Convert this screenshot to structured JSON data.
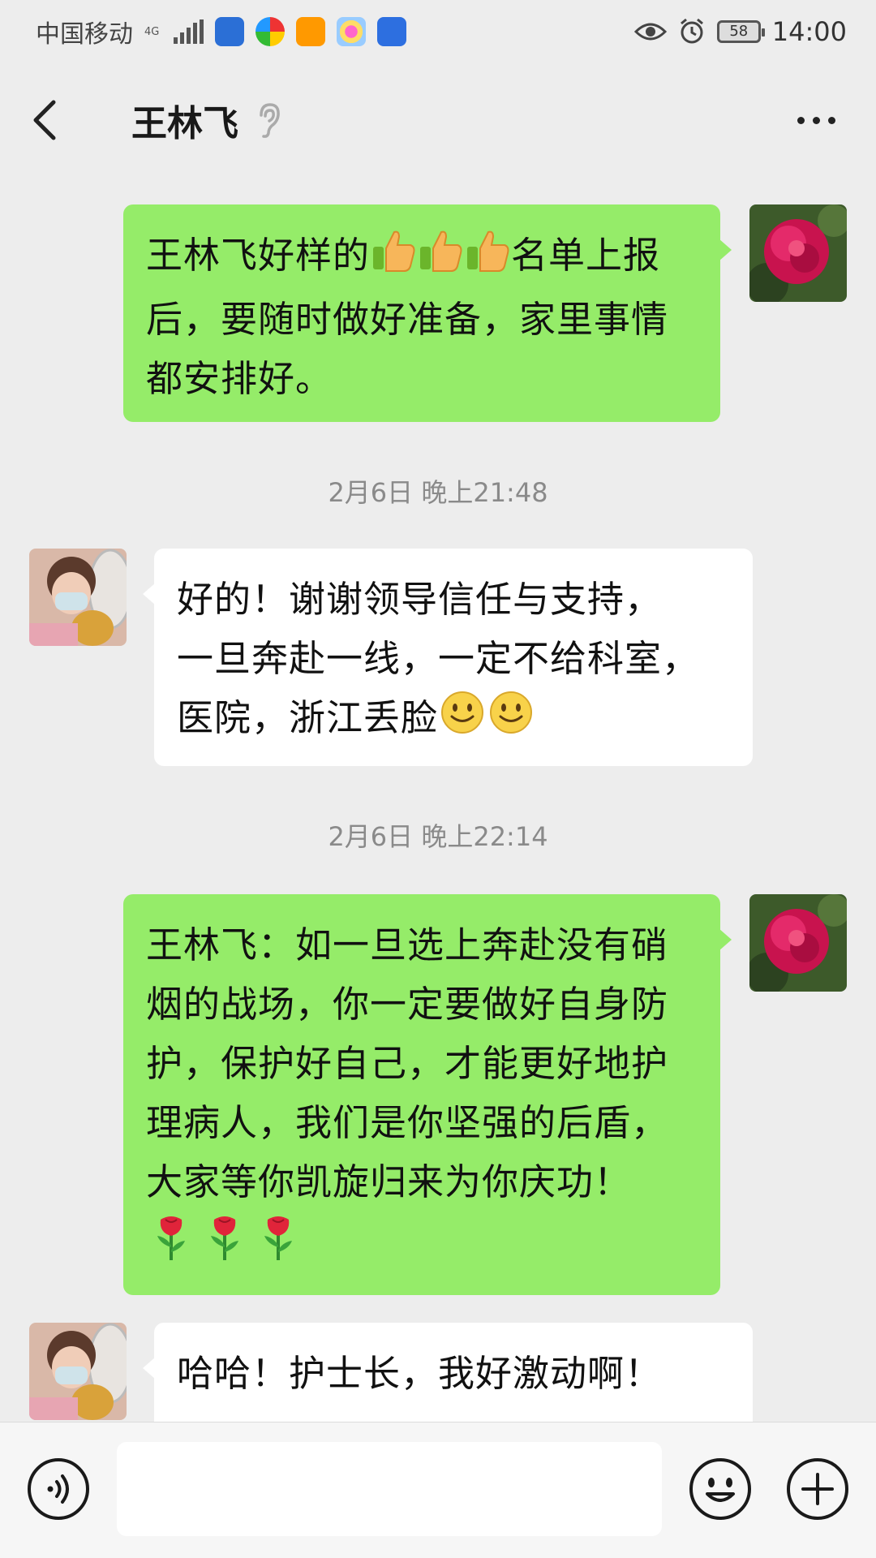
{
  "status_bar": {
    "carrier": "中国移动",
    "network": "4G",
    "battery": "58",
    "time": "14:00"
  },
  "header": {
    "contact_name": "王林飞",
    "back_icon": "chevron-left-icon",
    "mute_icon": "ear-icon",
    "more_icon": "more-dots-icon"
  },
  "messages": [
    {
      "side": "right",
      "text_lines": [
        "王林飞好样的",
        "名单上报",
        "后，要随时做好准备，家里事情",
        "都安排好。"
      ],
      "emoji": "thumbs-up"
    },
    {
      "timestamp": "2月6日 晚上21:48"
    },
    {
      "side": "left",
      "text_lines": [
        "好的！谢谢领导信任与支持，",
        "一旦奔赴一线，一定不给科室，",
        "医院，浙江丢脸"
      ],
      "emoji": "smile"
    },
    {
      "timestamp": "2月6日 晚上22:14"
    },
    {
      "side": "right",
      "text_lines": [
        "王林飞：如一旦选上奔赴没有硝",
        "烟的战场，你一定要做好自身防",
        "护，保护好自己，才能更好地护",
        "理病人，我们是你坚强的后盾，",
        "大家等你凯旋归来为你庆功！"
      ],
      "emoji": "rose"
    },
    {
      "side": "left",
      "text_lines": [
        "哈哈！护士长，我好激动啊！"
      ]
    }
  ],
  "input_bar": {
    "placeholder": "",
    "voice_icon": "voice-icon",
    "emoji_icon": "emoji-icon",
    "plus_icon": "plus-icon"
  }
}
